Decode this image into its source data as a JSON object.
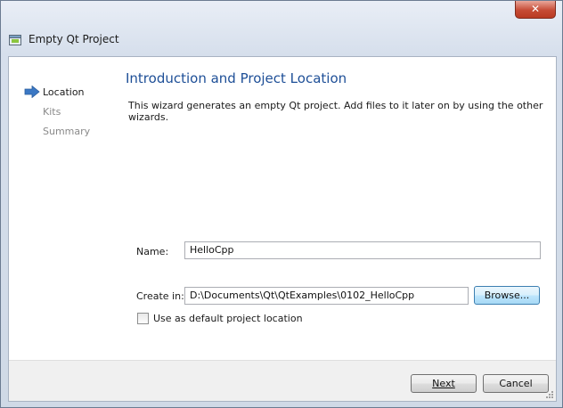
{
  "window": {
    "title": "Empty Qt Project",
    "close_label": "✕"
  },
  "sidebar": {
    "items": [
      {
        "label": "Location",
        "active": true
      },
      {
        "label": "Kits",
        "active": false
      },
      {
        "label": "Summary",
        "active": false
      }
    ]
  },
  "page": {
    "heading": "Introduction and Project Location",
    "description": "This wizard generates an empty Qt project. Add files to it later on by using the other wizards."
  },
  "form": {
    "name_label": "Name:",
    "name_value": "HelloCpp",
    "create_in_label": "Create in:",
    "create_in_value": "D:\\Documents\\Qt\\QtExamples\\0102_HelloCpp",
    "browse_label": "Browse...",
    "default_location_label": "Use as default project location",
    "default_location_checked": false
  },
  "buttons": {
    "next_label": "Next",
    "cancel_label": "Cancel"
  },
  "colors": {
    "heading": "#1e4f97",
    "inactive_text": "#8a8a8a",
    "arrow": "#3b78c4"
  },
  "icons": {
    "app": "qt-project-icon",
    "arrow": "current-step-arrow-icon",
    "close": "close-icon"
  }
}
